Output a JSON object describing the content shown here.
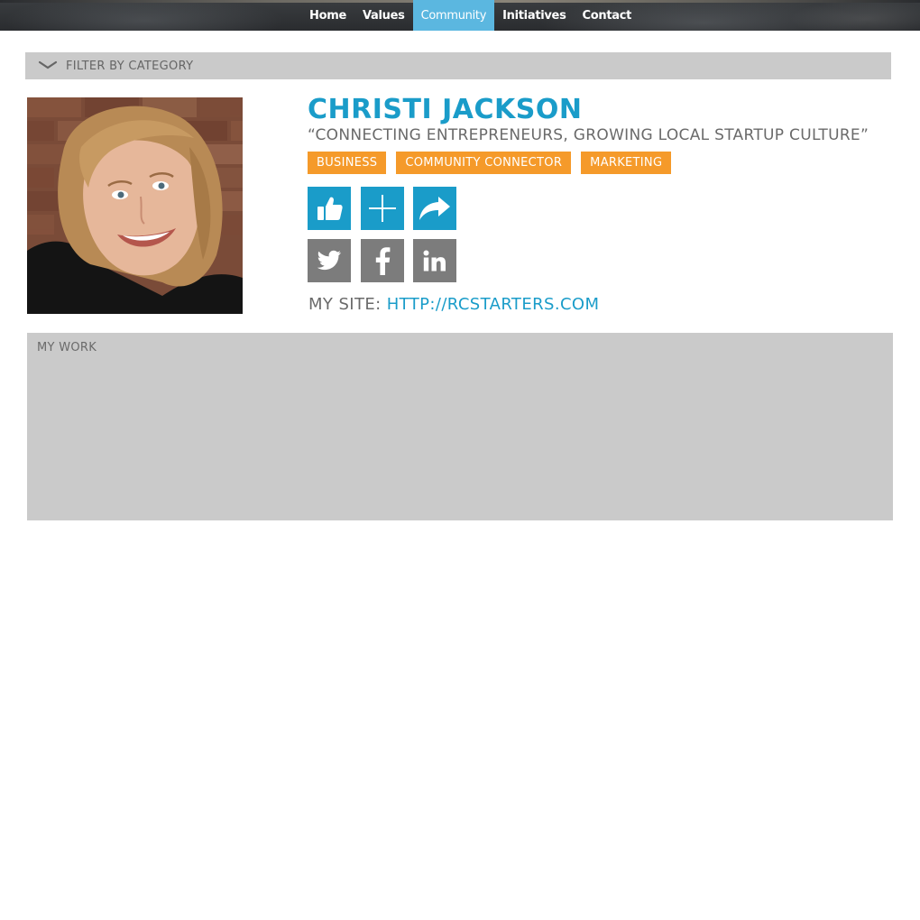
{
  "nav": {
    "items": [
      {
        "label": "Home"
      },
      {
        "label": "Values"
      },
      {
        "label": "Community",
        "active": true
      },
      {
        "label": "Initiatives"
      },
      {
        "label": "Contact"
      }
    ]
  },
  "filter": {
    "label": "Filter by category",
    "icon": "chevron-down-icon"
  },
  "profile": {
    "name": "Christi Jackson",
    "tagline": "“Connecting entrepreneurs, growing local startup culture”",
    "tags": [
      "Business",
      "Community Connector",
      "Marketing"
    ],
    "actions": [
      "thumbs-up-icon",
      "plus-icon",
      "share-icon"
    ],
    "social": [
      "twitter-icon",
      "facebook-icon",
      "linkedin-icon"
    ],
    "site_label": "My site:",
    "site_url": "http://rcstarters.com"
  },
  "work": {
    "title": "My work"
  },
  "colors": {
    "accent_blue": "#1a9cc9",
    "nav_active": "#5bb7e0",
    "tag_orange": "#f59a2a",
    "panel_gray": "#cacaca",
    "social_gray": "#7c7c7c"
  }
}
